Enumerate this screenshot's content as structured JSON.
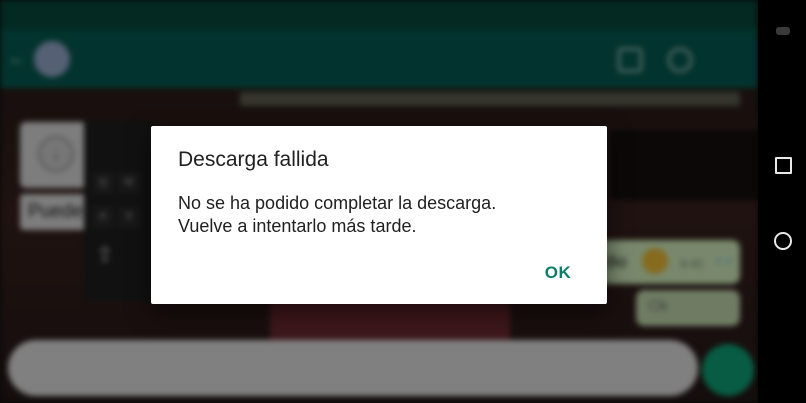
{
  "dialog": {
    "title": "Descarga fallida",
    "message_line1": "No se ha podido completar la descarga.",
    "message_line2": "Vuelve a intentarlo más tarde.",
    "ok_label": "OK"
  },
  "background": {
    "download_icon": "download-arrow-icon",
    "suggestion_text": "Puede",
    "keyboard_keys": [
      "Q",
      "W",
      "A",
      "S"
    ],
    "outgoing_message_text": "dio",
    "outgoing_message_time": "9:40",
    "outgoing_message_text_2": "Ok"
  },
  "navbar": {
    "recents_icon": "recents-square-icon",
    "home_icon": "home-circle-icon"
  },
  "colors": {
    "accent": "#0b7e6a",
    "appbar": "#075e54",
    "bubble": "#dcf8c6",
    "dialog_bg": "#ffffff"
  }
}
